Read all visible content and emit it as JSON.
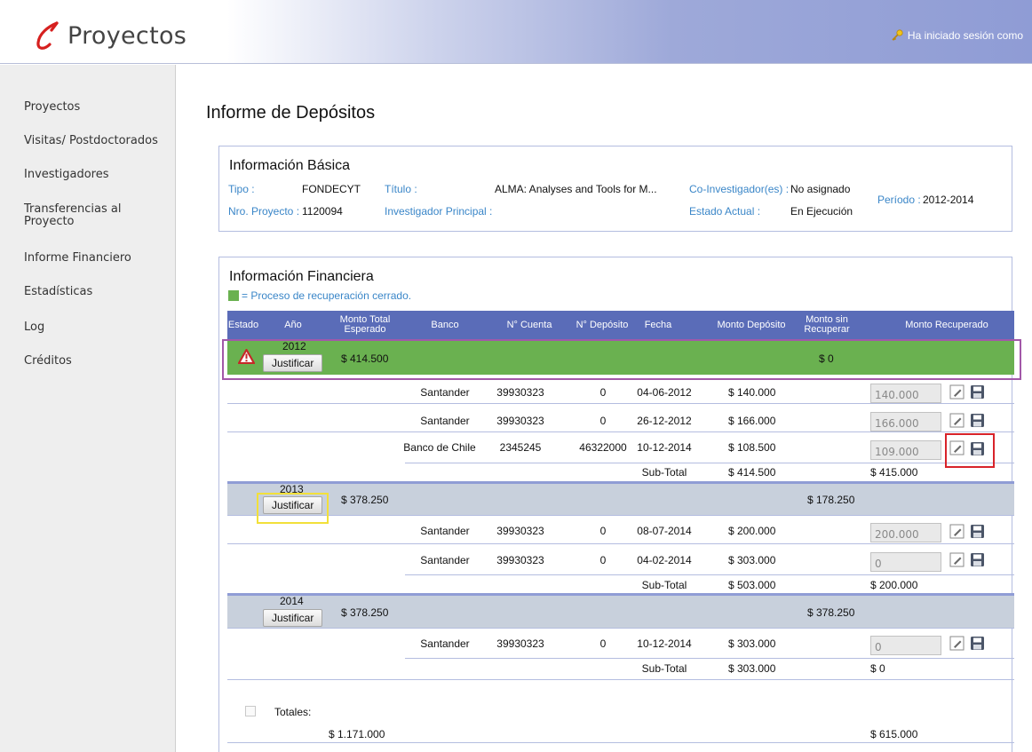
{
  "header": {
    "app_name": "Proyectos",
    "session_text": "Ha iniciado sesión como"
  },
  "sidebar": {
    "items": [
      {
        "label": "Proyectos"
      },
      {
        "label": "Visitas/ Postdoctorados"
      },
      {
        "label": "Investigadores"
      },
      {
        "label": "Transferencias al"
      },
      {
        "label": "Informe Financiero"
      },
      {
        "label": "Estadísticas"
      },
      {
        "label": "Log"
      },
      {
        "label": "Créditos"
      }
    ],
    "transfer_line2": "Proyecto"
  },
  "page_title": "Informe de Depósitos",
  "basic_info": {
    "title": "Información Básica",
    "tipo_label": "Tipo :",
    "tipo_value": "FONDECYT",
    "titulo_label": "Título :",
    "titulo_value": "ALMA: Analyses and Tools for M...",
    "coinv_label": "Co-Investigador(es) :",
    "coinv_value": "No asignado",
    "periodo_label": "Período :",
    "periodo_value": "2012-2014",
    "nro_label": "Nro. Proyecto :",
    "nro_value": "1120094",
    "ip_label": "Investigador Principal :",
    "estado_label": "Estado Actual :",
    "estado_value": "En Ejecución"
  },
  "financial": {
    "title": "Información Financiera",
    "legend": "= Proceso de recuperación cerrado.",
    "legend_color": "#6ab150",
    "columns": {
      "estado": "Estado",
      "anio": "Año",
      "monto_total_1": "Monto Total",
      "monto_total_2": "Esperado",
      "banco": "Banco",
      "cuenta": "N° Cuenta",
      "deposito": "N° Depósito",
      "fecha": "Fecha",
      "monto_deposito": "Monto Depósito",
      "sin_rec_1": "Monto sin",
      "sin_rec_2": "Recuperar",
      "recuperado": "Monto Recuperado"
    },
    "justify_label": "Justificar",
    "subtotal_label": "Sub-Total",
    "years": [
      {
        "year": "2012",
        "expected": "$ 414.500",
        "unrecovered": "$ 0",
        "deposits": [
          {
            "bank": "Santander",
            "account": "39930323",
            "deposit": "0",
            "date": "04-06-2012",
            "amount": "$ 140.000",
            "recovered": "140.000"
          },
          {
            "bank": "Santander",
            "account": "39930323",
            "deposit": "0",
            "date": "26-12-2012",
            "amount": "$ 166.000",
            "recovered": "166.000"
          },
          {
            "bank": "Banco de Chile",
            "account": "2345245",
            "deposit": "46322000",
            "date": "10-12-2014",
            "amount": "$ 108.500",
            "recovered": "109.000"
          }
        ],
        "subtotal_deposit": "$ 414.500",
        "subtotal_recovered": "$ 415.000"
      },
      {
        "year": "2013",
        "expected": "$ 378.250",
        "unrecovered": "$ 178.250",
        "deposits": [
          {
            "bank": "Santander",
            "account": "39930323",
            "deposit": "0",
            "date": "08-07-2014",
            "amount": "$ 200.000",
            "recovered": "200.000"
          },
          {
            "bank": "Santander",
            "account": "39930323",
            "deposit": "0",
            "date": "04-02-2014",
            "amount": "$ 303.000",
            "recovered": "0"
          }
        ],
        "subtotal_deposit": "$ 503.000",
        "subtotal_recovered": "$ 200.000"
      },
      {
        "year": "2014",
        "expected": "$ 378.250",
        "unrecovered": "$ 378.250",
        "deposits": [
          {
            "bank": "Santander",
            "account": "39930323",
            "deposit": "0",
            "date": "10-12-2014",
            "amount": "$ 303.000",
            "recovered": "0"
          }
        ],
        "subtotal_deposit": "$ 303.000",
        "subtotal_recovered": "$ 0"
      }
    ],
    "totals_label": "Totales:",
    "total_expected": "$ 1.171.000",
    "total_recovered": "$ 615.000"
  },
  "colors": {
    "header_blue": "#8f9cd5",
    "table_head": "#5a6cb8",
    "closed_green": "#6ab150",
    "year_row": "#c8d0dc",
    "label_blue": "#3a86c8"
  }
}
